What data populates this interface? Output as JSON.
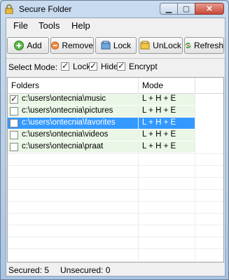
{
  "window": {
    "title": "Secure Folder"
  },
  "menu": [
    "File",
    "Tools",
    "Help"
  ],
  "toolbar": {
    "add": "Add",
    "remove": "Remove",
    "lock": "Lock",
    "unlock": "UnLock",
    "refresh": "Refresh"
  },
  "mode": {
    "label": "Select Mode:",
    "options": [
      {
        "label": "Lock",
        "checked": true
      },
      {
        "label": "Hide",
        "checked": true
      },
      {
        "label": "Encrypt",
        "checked": true
      }
    ]
  },
  "table": {
    "columns": [
      "Folders",
      "Mode"
    ],
    "rows": [
      {
        "path": "c:\\users\\ontecnia\\music",
        "mode": "L + H + E",
        "checked": true,
        "selected": false
      },
      {
        "path": "c:\\users\\ontecnia\\pictures",
        "mode": "L + H + E",
        "checked": false,
        "selected": false
      },
      {
        "path": "c:\\users\\ontecnia\\favorites",
        "mode": "L + H + E",
        "checked": false,
        "selected": true
      },
      {
        "path": "c:\\users\\ontecnia\\videos",
        "mode": "L + H + E",
        "checked": false,
        "selected": false
      },
      {
        "path": "c:\\users\\ontecnia\\praat",
        "mode": "L + H + E",
        "checked": false,
        "selected": false
      }
    ]
  },
  "status": {
    "secured": "Secured: 5",
    "unsecured": "Unsecured: 0"
  },
  "colors": {
    "selection": "#3399ff",
    "row_tint": "#eaf6e6"
  },
  "icons": [
    "lock-icon",
    "add-icon",
    "remove-icon",
    "lock-icon",
    "unlock-icon",
    "refresh-icon"
  ]
}
